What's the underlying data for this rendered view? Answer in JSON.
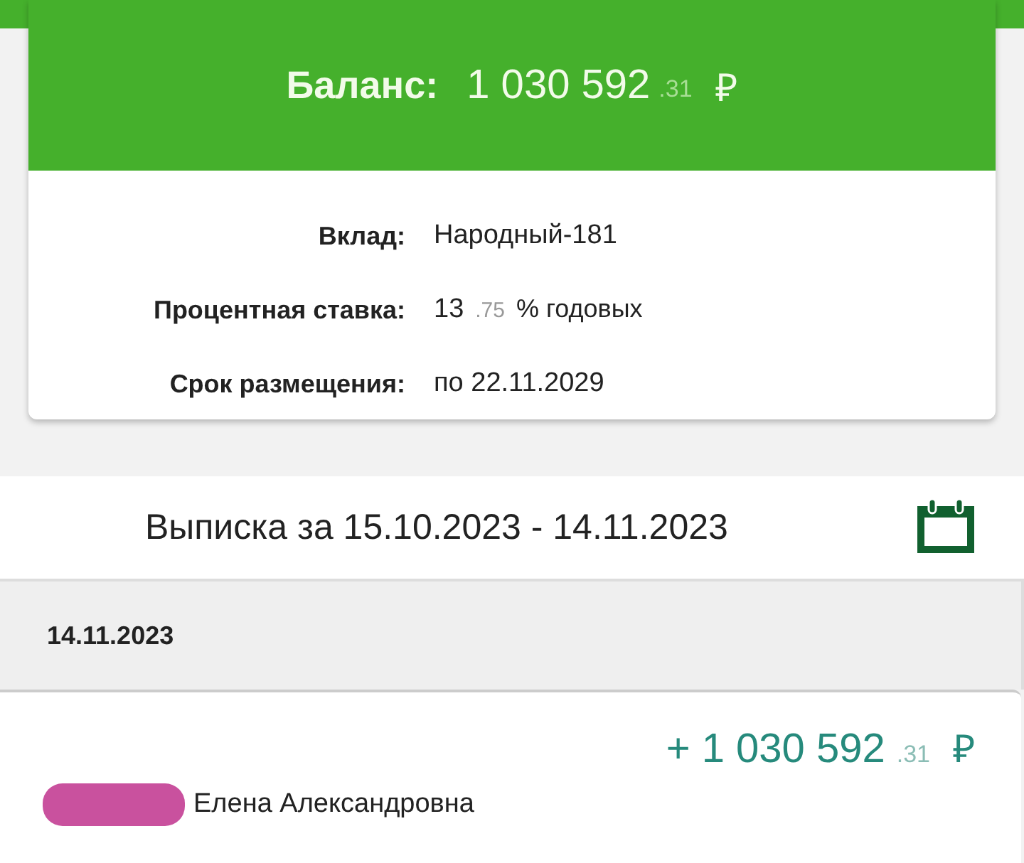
{
  "balance": {
    "label": "Баланс:",
    "amount": "1 030 592",
    "fraction": ".31",
    "currency": "₽"
  },
  "details": [
    {
      "label": "Вклад:",
      "value": "Народный-181"
    },
    {
      "label": "Процентная ставка:",
      "value": "13",
      "fraction": ".75",
      "suffix": "% годовых"
    },
    {
      "label": "Срок размещения:",
      "value": "по 22.11.2029"
    }
  ],
  "statement": {
    "title": "Выписка за 15.10.2023 - 14.11.2023"
  },
  "groups": [
    {
      "date": "14.11.2023",
      "transactions": [
        {
          "amount": "+ 1 030 592",
          "fraction": ".31",
          "currency": "₽",
          "name": "Елена Александровна",
          "redacted": true
        }
      ]
    }
  ]
}
